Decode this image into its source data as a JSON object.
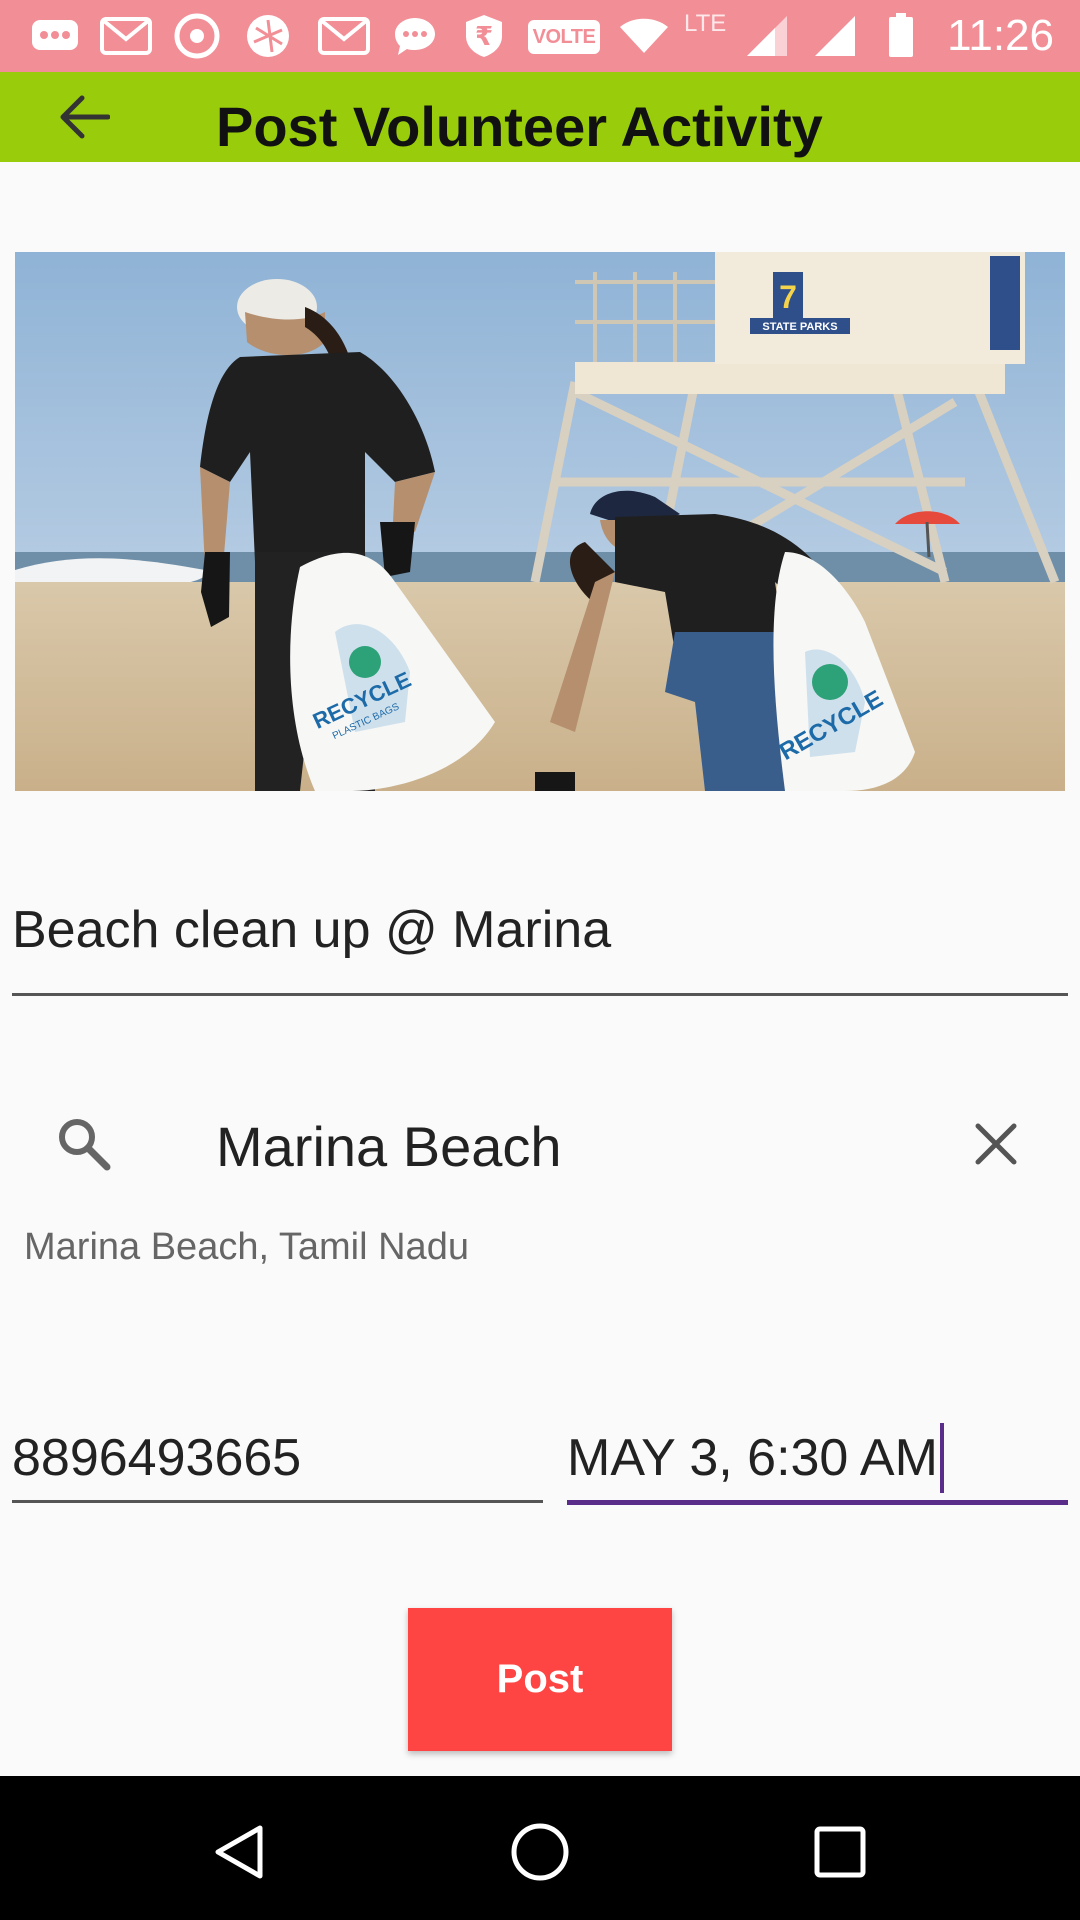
{
  "status_bar": {
    "time": "11:26",
    "volte": "VOLTE",
    "network": "LTE",
    "icons": [
      "messaging-icon",
      "gmail-icon",
      "chrome-icon",
      "app-icon",
      "gmail-icon",
      "chat-icon",
      "rupee-icon",
      "volte-icon",
      "wifi-icon",
      "signal-icon",
      "signal-icon",
      "battery-icon"
    ],
    "background": "#f28e96"
  },
  "app_bar": {
    "title": "Post Volunteer Activity",
    "back_icon": "arrow-back-icon",
    "background": "#99cc0a"
  },
  "form": {
    "title_value": "Beach clean up @ Marina",
    "place_search_value": "Marina Beach",
    "place_suggestion": "Marina Beach, Tamil Nadu",
    "phone_value": "8896493665",
    "datetime_value": "MAY 3, 6:30 AM",
    "focus_color": "#5b2d8a"
  },
  "image_text": {
    "bag_label": "RECYCLE",
    "bag_sub": "PLASTIC BAGS",
    "tower_number": "7",
    "tower_label": "STATE PARKS"
  },
  "post_button": {
    "label": "Post",
    "color": "#ff4444"
  },
  "nav_bar": {
    "icons": [
      "back-triangle-icon",
      "home-circle-icon",
      "recents-square-icon"
    ]
  }
}
